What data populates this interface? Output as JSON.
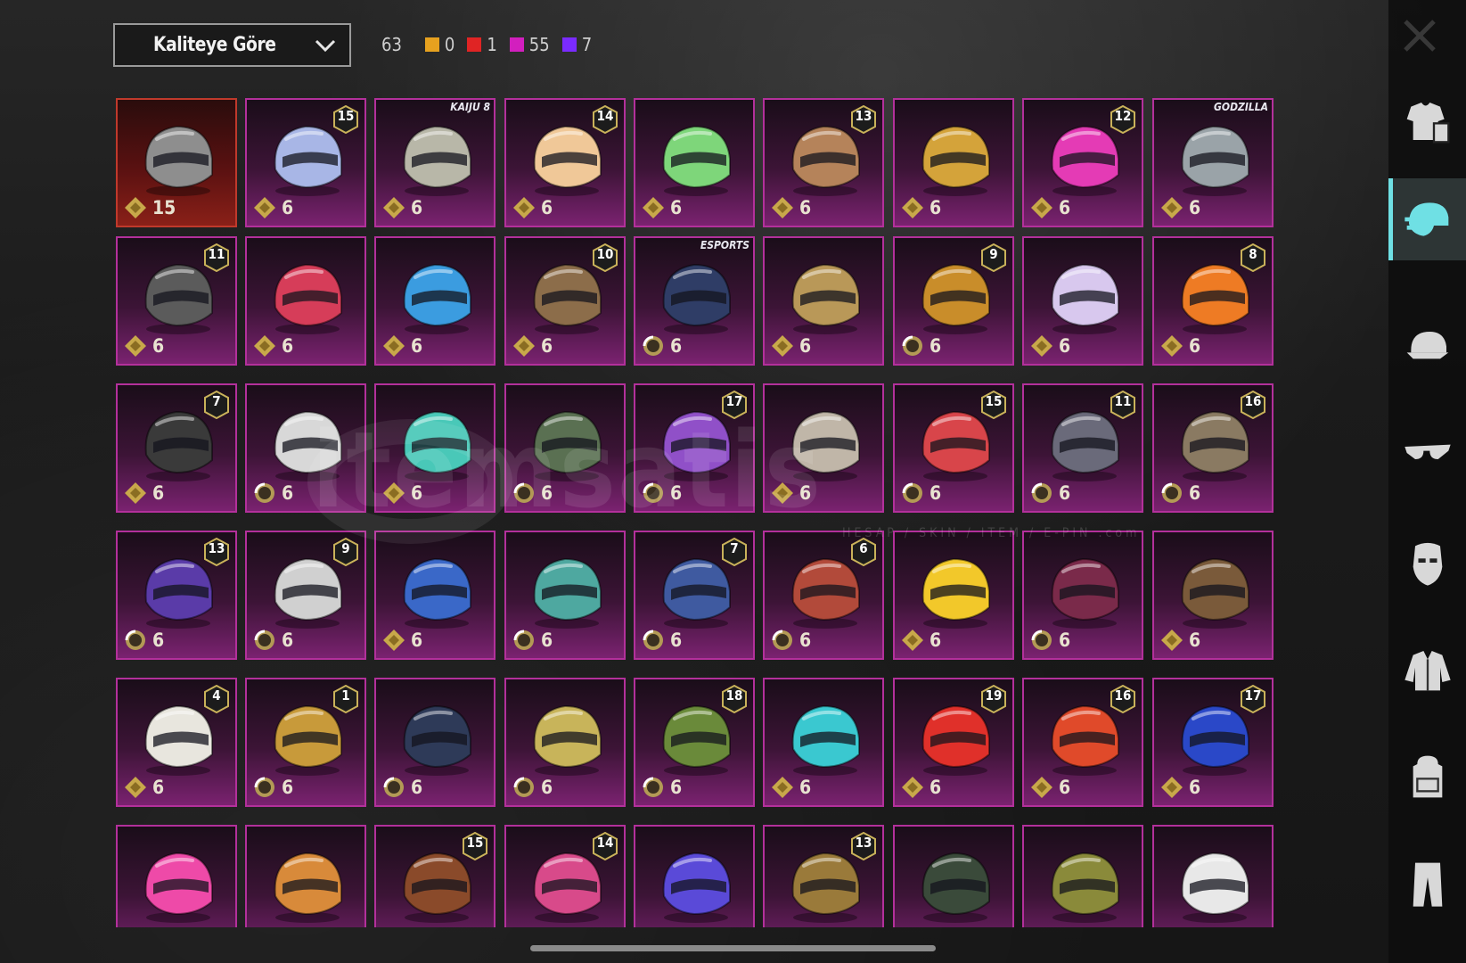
{
  "sort": {
    "label": "Kaliteye Göre"
  },
  "counts": {
    "total": "63",
    "items": [
      {
        "color": "#e6a11f",
        "value": "0"
      },
      {
        "color": "#e02424",
        "value": "1"
      },
      {
        "color": "#d21fbe",
        "value": "55"
      },
      {
        "color": "#7a2bff",
        "value": "7"
      }
    ]
  },
  "watermark": {
    "main": "itemsatis",
    "sub": "HESAP / SKIN / ITEM / E-PIN",
    "domain": ".com"
  },
  "sidebar": {
    "items": [
      {
        "name": "outfit-category-icon"
      },
      {
        "name": "helmet-category-icon",
        "active": true
      },
      {
        "name": "hat-category-icon"
      },
      {
        "name": "glasses-category-icon"
      },
      {
        "name": "mask-category-icon"
      },
      {
        "name": "jacket-category-icon"
      },
      {
        "name": "backpack-category-icon"
      },
      {
        "name": "pants-category-icon"
      }
    ]
  },
  "grid": {
    "items": [
      {
        "count": "15",
        "level": "",
        "color": "#8e8e8e",
        "frame": "red",
        "icon": "gold",
        "overlay": ""
      },
      {
        "count": "6",
        "level": "15",
        "color": "#a8b6e6",
        "icon": "gold",
        "overlay": ""
      },
      {
        "count": "6",
        "level": "",
        "color": "#b8b7a8",
        "icon": "gold",
        "overlay": "KAIJU 8"
      },
      {
        "count": "6",
        "level": "14",
        "color": "#f0c898",
        "icon": "gold",
        "overlay": ""
      },
      {
        "count": "6",
        "level": "",
        "color": "#7ed67a",
        "icon": "gold",
        "overlay": ""
      },
      {
        "count": "6",
        "level": "13",
        "color": "#b5835a",
        "icon": "gold",
        "overlay": ""
      },
      {
        "count": "6",
        "level": "",
        "color": "#d4a33a",
        "icon": "gold",
        "overlay": ""
      },
      {
        "count": "6",
        "level": "12",
        "color": "#e43bb5",
        "icon": "gold",
        "overlay": ""
      },
      {
        "count": "6",
        "level": "",
        "color": "#9aa3a8",
        "icon": "gold",
        "overlay": "GODZILLA"
      },
      {
        "count": "6",
        "level": "11",
        "color": "#5b5b5b",
        "icon": "gold",
        "overlay": ""
      },
      {
        "count": "6",
        "level": "",
        "color": "#d63d59",
        "icon": "gold",
        "overlay": ""
      },
      {
        "count": "6",
        "level": "",
        "color": "#3b9ce0",
        "icon": "gold",
        "overlay": ""
      },
      {
        "count": "6",
        "level": "10",
        "color": "#8c6d4a",
        "icon": "gold",
        "overlay": ""
      },
      {
        "count": "6",
        "level": "",
        "color": "#2f3d66",
        "icon": "ring",
        "overlay": "ESPORTS"
      },
      {
        "count": "6",
        "level": "",
        "color": "#b99858",
        "icon": "gold",
        "overlay": ""
      },
      {
        "count": "6",
        "level": "9",
        "color": "#c98d2a",
        "icon": "ring",
        "overlay": ""
      },
      {
        "count": "6",
        "level": "",
        "color": "#d8c8ee",
        "icon": "gold",
        "overlay": ""
      },
      {
        "count": "6",
        "level": "8",
        "color": "#ee7b24",
        "icon": "gold",
        "overlay": ""
      },
      {
        "count": "6",
        "level": "7",
        "color": "#3a3a3a",
        "icon": "gold",
        "overlay": ""
      },
      {
        "count": "6",
        "level": "",
        "color": "#d8d8d8",
        "icon": "ring",
        "overlay": ""
      },
      {
        "count": "6",
        "level": "",
        "color": "#49c8b8",
        "icon": "gold",
        "overlay": ""
      },
      {
        "count": "6",
        "level": "",
        "color": "#5a7052",
        "icon": "ring",
        "overlay": ""
      },
      {
        "count": "6",
        "level": "17",
        "color": "#9050c8",
        "icon": "ring",
        "overlay": ""
      },
      {
        "count": "6",
        "level": "",
        "color": "#c0b6a8",
        "icon": "gold",
        "overlay": ""
      },
      {
        "count": "6",
        "level": "15",
        "color": "#d8454a",
        "icon": "ring",
        "overlay": ""
      },
      {
        "count": "6",
        "level": "11",
        "color": "#6a6a7a",
        "icon": "ring",
        "overlay": ""
      },
      {
        "count": "6",
        "level": "16",
        "color": "#8a7a62",
        "icon": "ring",
        "overlay": ""
      },
      {
        "count": "6",
        "level": "13",
        "color": "#5a3ba8",
        "icon": "ring",
        "overlay": ""
      },
      {
        "count": "6",
        "level": "9",
        "color": "#d0d0d0",
        "icon": "ring",
        "overlay": ""
      },
      {
        "count": "6",
        "level": "",
        "color": "#3a68c8",
        "icon": "gold",
        "overlay": ""
      },
      {
        "count": "6",
        "level": "",
        "color": "#4ea8a0",
        "icon": "ring",
        "overlay": ""
      },
      {
        "count": "6",
        "level": "7",
        "color": "#3f5aa0",
        "icon": "ring",
        "overlay": ""
      },
      {
        "count": "6",
        "level": "6",
        "color": "#b24a3a",
        "icon": "ring",
        "overlay": ""
      },
      {
        "count": "6",
        "level": "",
        "color": "#f2c82a",
        "icon": "gold",
        "overlay": ""
      },
      {
        "count": "6",
        "level": "",
        "color": "#7a2a4a",
        "icon": "ring",
        "overlay": ""
      },
      {
        "count": "6",
        "level": "",
        "color": "#7a5a3a",
        "icon": "gold",
        "overlay": ""
      },
      {
        "count": "6",
        "level": "4",
        "color": "#e8e6de",
        "icon": "gold",
        "overlay": ""
      },
      {
        "count": "6",
        "level": "1",
        "color": "#c89a3a",
        "icon": "ring",
        "overlay": ""
      },
      {
        "count": "6",
        "level": "",
        "color": "#2e3a58",
        "icon": "ring",
        "overlay": ""
      },
      {
        "count": "6",
        "level": "",
        "color": "#c8b45a",
        "icon": "ring",
        "overlay": ""
      },
      {
        "count": "6",
        "level": "18",
        "color": "#6a8a3a",
        "icon": "ring",
        "overlay": ""
      },
      {
        "count": "6",
        "level": "",
        "color": "#3ac8d0",
        "icon": "gold",
        "overlay": ""
      },
      {
        "count": "6",
        "level": "19",
        "color": "#e0302a",
        "icon": "gold",
        "overlay": ""
      },
      {
        "count": "6",
        "level": "16",
        "color": "#e04a2a",
        "icon": "gold",
        "overlay": ""
      },
      {
        "count": "6",
        "level": "17",
        "color": "#2a48c8",
        "icon": "gold",
        "overlay": ""
      },
      {
        "count": "",
        "level": "",
        "color": "#ee4aa8",
        "icon": "",
        "overlay": ""
      },
      {
        "count": "",
        "level": "",
        "color": "#d88a3a",
        "icon": "",
        "overlay": ""
      },
      {
        "count": "",
        "level": "15",
        "color": "#8a4a2a",
        "icon": "",
        "overlay": ""
      },
      {
        "count": "",
        "level": "14",
        "color": "#d84a8a",
        "icon": "",
        "overlay": ""
      },
      {
        "count": "",
        "level": "",
        "color": "#5a4ad8",
        "icon": "",
        "overlay": ""
      },
      {
        "count": "",
        "level": "13",
        "color": "#9a7a3a",
        "icon": "",
        "overlay": ""
      },
      {
        "count": "",
        "level": "",
        "color": "#3a4a3a",
        "icon": "",
        "overlay": ""
      },
      {
        "count": "",
        "level": "",
        "color": "#8a8a3a",
        "icon": "",
        "overlay": ""
      },
      {
        "count": "",
        "level": "",
        "color": "#e8e8e8",
        "icon": "",
        "overlay": ""
      }
    ]
  }
}
